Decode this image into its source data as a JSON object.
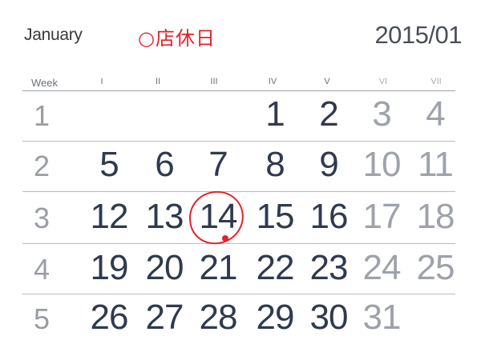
{
  "header": {
    "month": "January",
    "note": "○店休日",
    "year_month": "2015/01"
  },
  "colors": {
    "note_red": "#e2232b",
    "weekday_text": "#2f3a4e",
    "weekend_text": "#9ea2ab",
    "rule": "#b8bbc0"
  },
  "columns": {
    "week_label": "Week",
    "days": [
      "I",
      "II",
      "III",
      "IV",
      "V",
      "VI",
      "VII"
    ]
  },
  "weeks": [
    {
      "num": "1",
      "days": [
        "",
        "",
        "",
        "1",
        "2",
        "3",
        "4"
      ]
    },
    {
      "num": "2",
      "days": [
        "5",
        "6",
        "7",
        "8",
        "9",
        "10",
        "11"
      ]
    },
    {
      "num": "3",
      "days": [
        "12",
        "13",
        "14",
        "15",
        "16",
        "17",
        "18"
      ]
    },
    {
      "num": "4",
      "days": [
        "19",
        "20",
        "21",
        "22",
        "23",
        "24",
        "25"
      ]
    },
    {
      "num": "5",
      "days": [
        "26",
        "27",
        "28",
        "29",
        "30",
        "31",
        ""
      ]
    }
  ],
  "highlighted_day": "14"
}
